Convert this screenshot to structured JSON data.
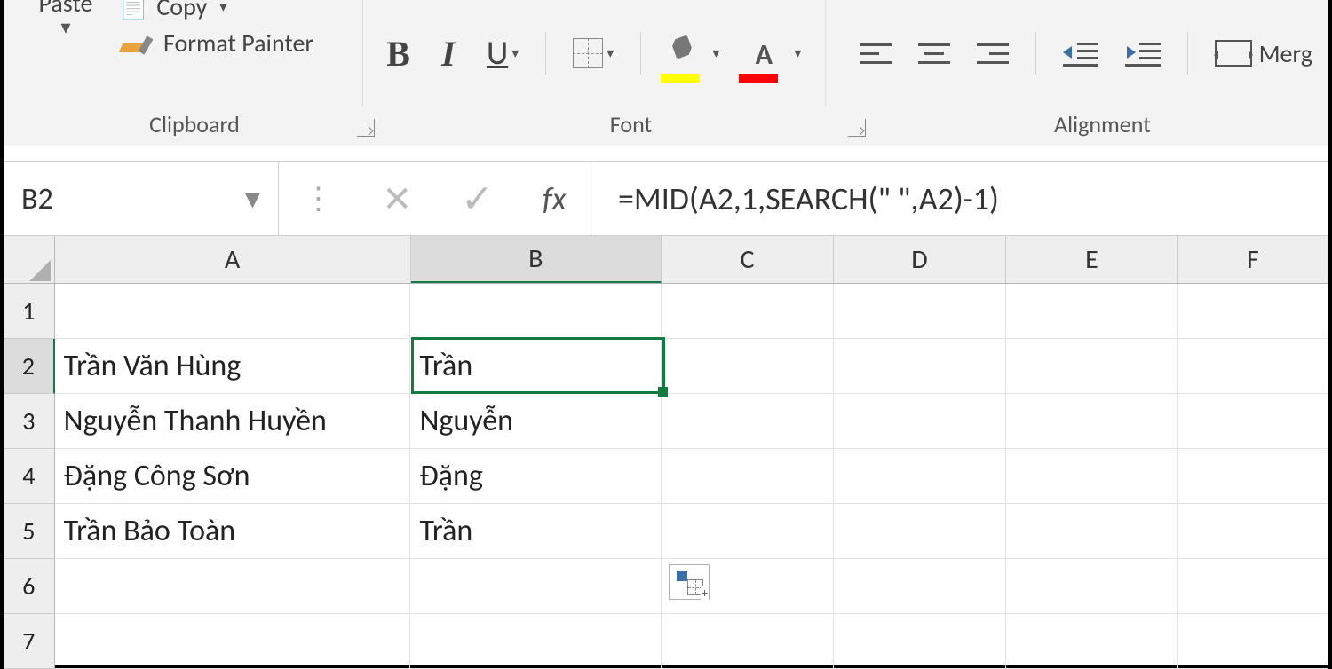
{
  "ribbon": {
    "clipboard": {
      "paste": "Paste",
      "copy": "Copy",
      "format_painter": "Format Painter",
      "group_label": "Clipboard"
    },
    "font": {
      "bold": "B",
      "italic": "I",
      "underline": "U",
      "group_label": "Font",
      "fill_color": "#ffff00",
      "font_color": "#ff0000"
    },
    "alignment": {
      "merge_label": "Merg",
      "group_label": "Alignment"
    }
  },
  "formula_bar": {
    "name_box": "B2",
    "fx_label": "fx",
    "formula": "=MID(A2,1,SEARCH(\" \",A2)-1)"
  },
  "grid": {
    "columns": [
      "A",
      "B",
      "C",
      "D",
      "E",
      "F"
    ],
    "selected_column": "B",
    "row_count": 7,
    "selected_row": 2,
    "selected_cell": "B2",
    "cells": {
      "A2": "Trần Văn Hùng",
      "A3": "Nguyễn Thanh Huyền",
      "A4": "Đặng Công Sơn",
      "A5": "Trần Bảo Toàn",
      "B2": "Trần",
      "B3": "Nguyễn",
      "B4": "Đặng",
      "B5": "Trần"
    }
  },
  "chart_data": {
    "type": "table",
    "headers": [
      "A",
      "B"
    ],
    "rows": [
      [
        "Trần Văn Hùng",
        "Trần"
      ],
      [
        "Nguyễn Thanh Huyền",
        "Nguyễn"
      ],
      [
        "Đặng Công Sơn",
        "Đặng"
      ],
      [
        "Trần Bảo Toàn",
        "Trần"
      ]
    ],
    "formula_B": "=MID(A2,1,SEARCH(\" \",A2)-1)"
  }
}
